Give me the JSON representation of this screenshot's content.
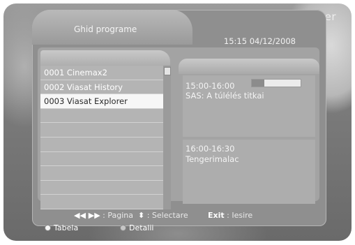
{
  "screen": {
    "channel_logo": "e. plorer",
    "title": "Ghid programe",
    "datetime": "15:15 04/12/2008"
  },
  "channels": [
    {
      "label": "0001 Cinemax2",
      "selected": false
    },
    {
      "label": "0002 Viasat History",
      "selected": false
    },
    {
      "label": "0003 Viasat Explorer",
      "selected": true
    },
    {
      "label": "",
      "selected": false
    },
    {
      "label": "",
      "selected": false
    },
    {
      "label": "",
      "selected": false
    },
    {
      "label": "",
      "selected": false
    },
    {
      "label": "",
      "selected": false
    },
    {
      "label": "",
      "selected": false
    },
    {
      "label": "",
      "selected": false
    }
  ],
  "events": [
    {
      "time": "15:00-16:00",
      "title": "SAS: A túlélés titkai",
      "progress": 0.25
    },
    {
      "time": "16:00-16:30",
      "title": "Tengerimalac"
    }
  ],
  "footer": {
    "page_keys": "◀◀ ▶▶",
    "page_label": ": Pagina",
    "select_key": "⬍",
    "select_label": ": Selectare",
    "exit_key": "Exit",
    "exit_label": ": Iesire"
  },
  "buttons": {
    "tabela": "Tabela",
    "detalii": "Detalii"
  },
  "colors": {
    "panel": "#8f8f8f",
    "selected_row": "#f7f7f7",
    "text": "#ffffff"
  }
}
